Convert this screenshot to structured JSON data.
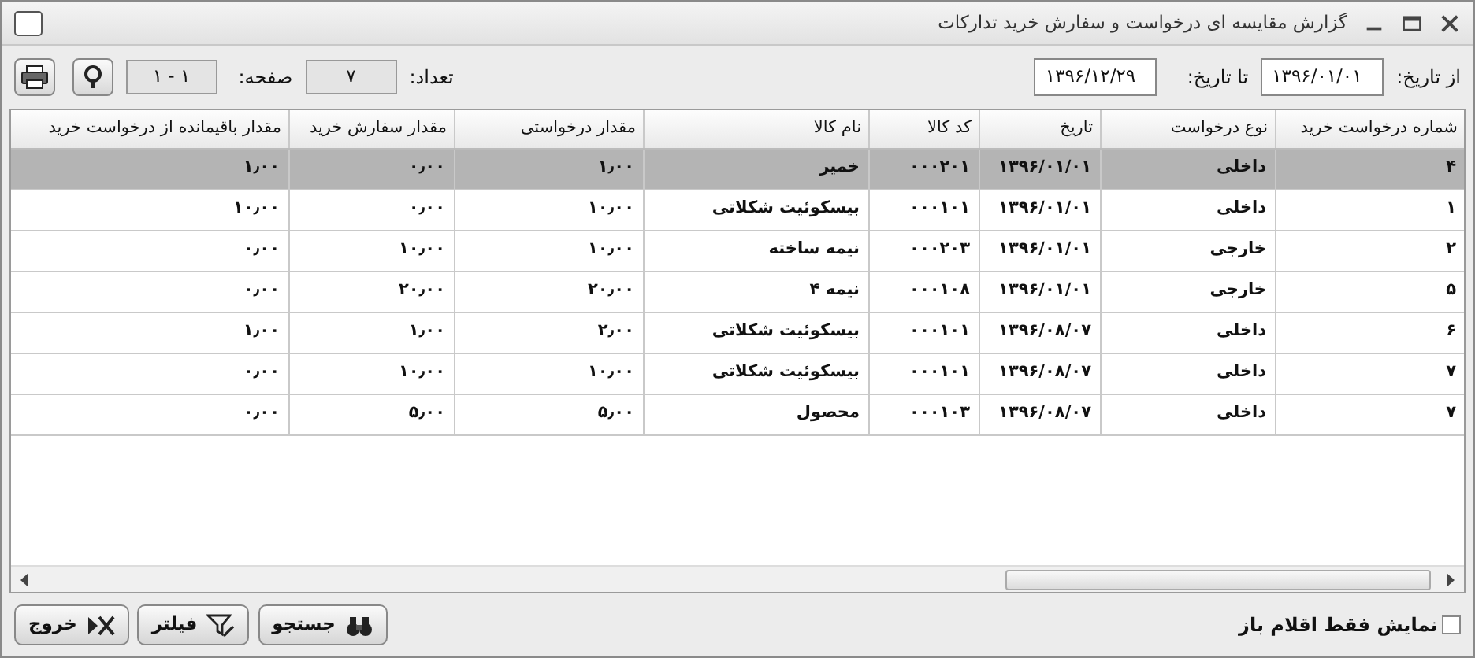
{
  "window": {
    "title": "گزارش مقایسه ای درخواست و سفارش خرید تدارکات"
  },
  "filters": {
    "from_label": "از تاریخ:",
    "from_value": "۱۳۹۶/۰۱/۰۱",
    "to_label": "تا تاریخ:",
    "to_value": "۱۳۹۶/۱۲/۲۹",
    "count_label": "تعداد:",
    "count_value": "۷",
    "page_label": "صفحه:",
    "page_value": "۱ - ۱"
  },
  "table": {
    "columns": [
      "شماره درخواست خرید",
      "نوع درخواست",
      "تاریخ",
      "کد کالا",
      "نام کالا",
      "مقدار درخواستی",
      "مقدار سفارش خرید",
      "مقدار باقیمانده از درخواست خرید"
    ],
    "rows": [
      {
        "selected": true,
        "cells": [
          "۴",
          "داخلی",
          "۱۳۹۶/۰۱/۰۱",
          "۰۰۰۲۰۱",
          "خمیر",
          "۱٫۰۰",
          "۰٫۰۰",
          "۱٫۰۰"
        ]
      },
      {
        "selected": false,
        "cells": [
          "۱",
          "داخلی",
          "۱۳۹۶/۰۱/۰۱",
          "۰۰۰۱۰۱",
          "بیسکوئیت شکلاتی",
          "۱۰٫۰۰",
          "۰٫۰۰",
          "۱۰٫۰۰"
        ]
      },
      {
        "selected": false,
        "cells": [
          "۲",
          "خارجی",
          "۱۳۹۶/۰۱/۰۱",
          "۰۰۰۲۰۳",
          "نیمه ساخته",
          "۱۰٫۰۰",
          "۱۰٫۰۰",
          "۰٫۰۰"
        ]
      },
      {
        "selected": false,
        "cells": [
          "۵",
          "خارجی",
          "۱۳۹۶/۰۱/۰۱",
          "۰۰۰۱۰۸",
          "نیمه ۴",
          "۲۰٫۰۰",
          "۲۰٫۰۰",
          "۰٫۰۰"
        ]
      },
      {
        "selected": false,
        "cells": [
          "۶",
          "داخلی",
          "۱۳۹۶/۰۸/۰۷",
          "۰۰۰۱۰۱",
          "بیسکوئیت شکلاتی",
          "۲٫۰۰",
          "۱٫۰۰",
          "۱٫۰۰"
        ]
      },
      {
        "selected": false,
        "cells": [
          "۷",
          "داخلی",
          "۱۳۹۶/۰۸/۰۷",
          "۰۰۰۱۰۱",
          "بیسکوئیت شکلاتی",
          "۱۰٫۰۰",
          "۱۰٫۰۰",
          "۰٫۰۰"
        ]
      },
      {
        "selected": false,
        "cells": [
          "۷",
          "داخلی",
          "۱۳۹۶/۰۸/۰۷",
          "۰۰۰۱۰۳",
          "محصول",
          "۵٫۰۰",
          "۵٫۰۰",
          "۰٫۰۰"
        ]
      }
    ]
  },
  "footer": {
    "open_only": {
      "label": "نمایش فقط اقلام باز",
      "checked": false
    },
    "buttons": [
      "جستجو",
      "فیلتر",
      "خروج"
    ]
  }
}
